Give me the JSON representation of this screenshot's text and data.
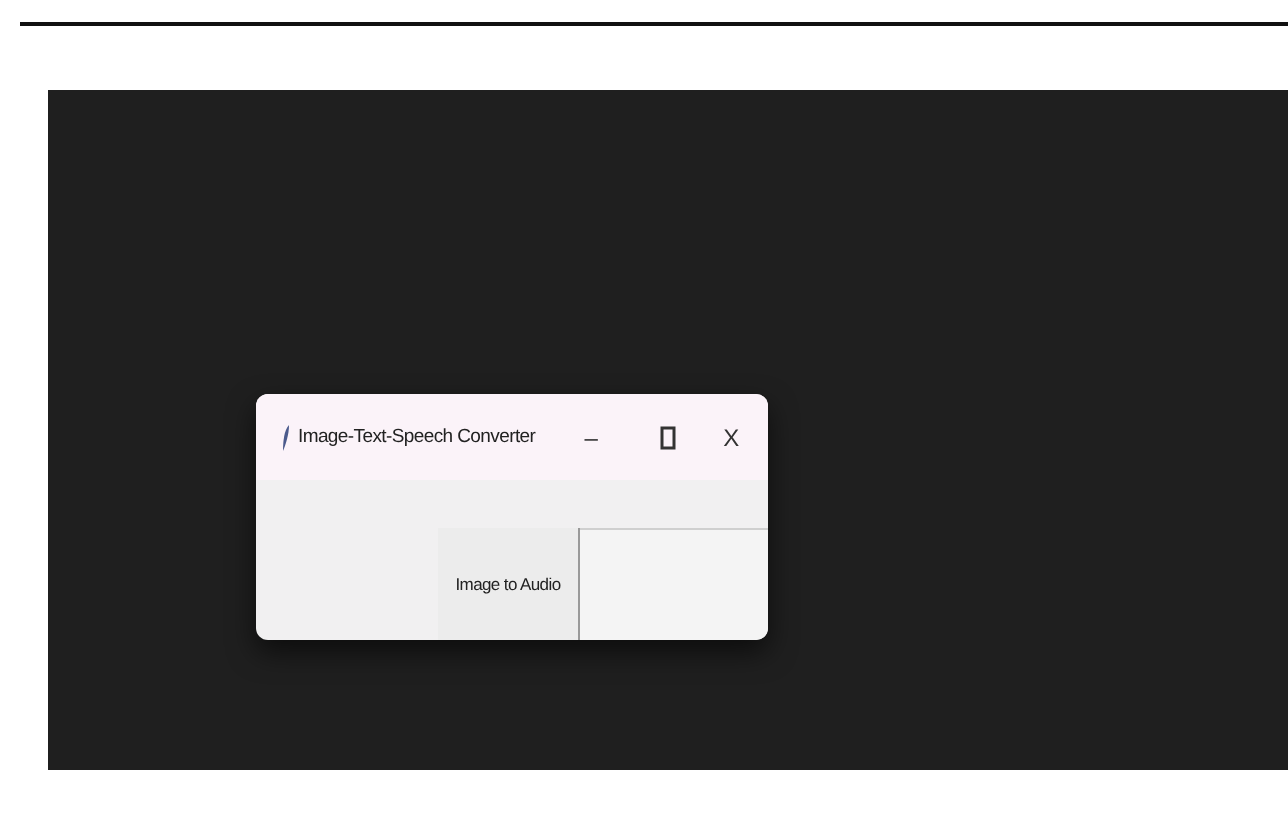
{
  "window": {
    "title": "Image-Text-Speech Converter",
    "minimize": "–",
    "close": "X"
  },
  "button": {
    "label": "Image to Audio"
  }
}
